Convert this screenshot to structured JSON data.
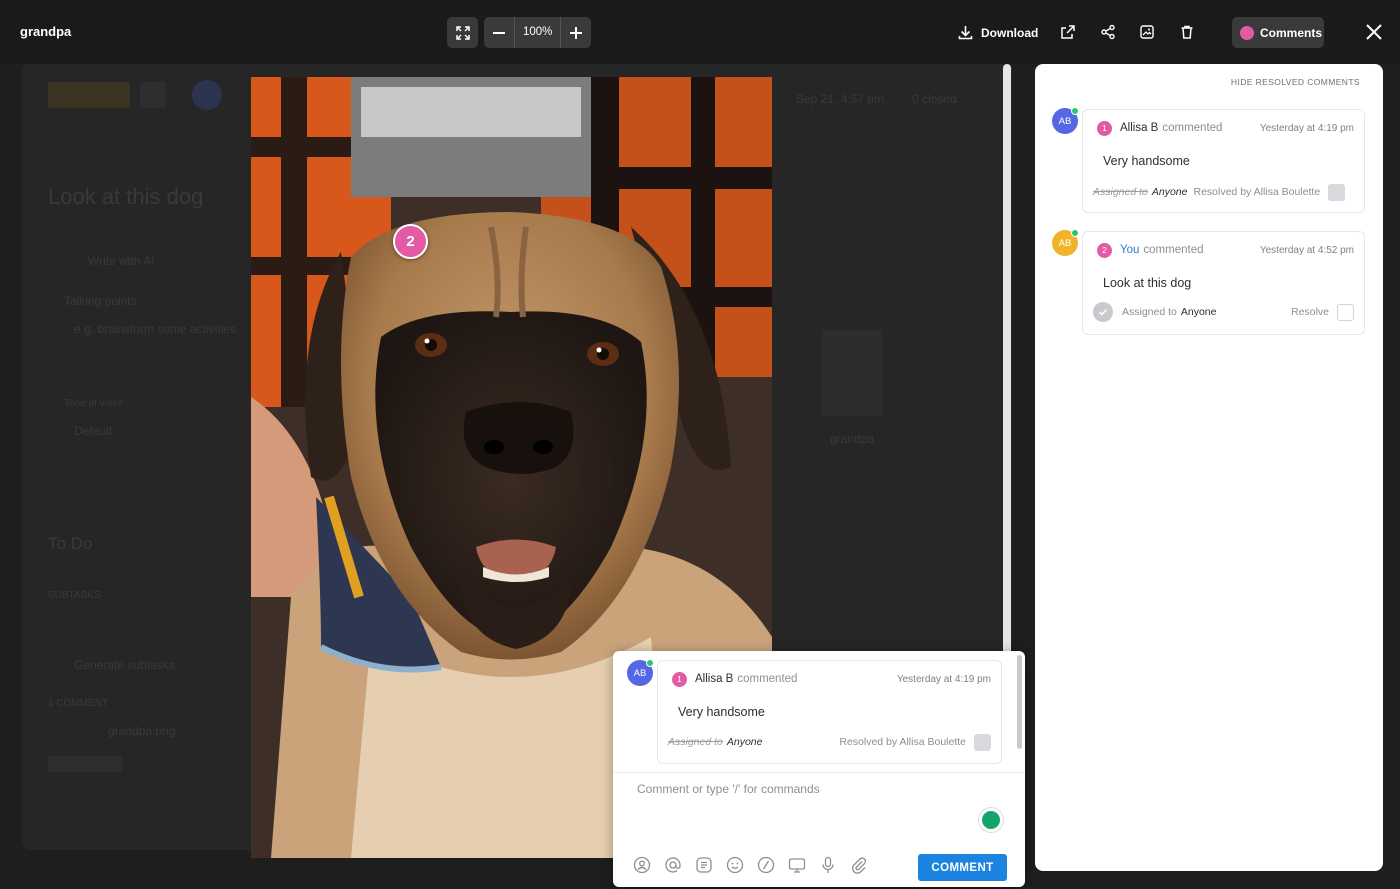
{
  "topbar": {
    "file_name": "grandpa",
    "zoom": "100%",
    "download_label": "Download",
    "comments_label": "Comments"
  },
  "background_page": {
    "title": "Look at this dog",
    "write_ai": "Write with AI",
    "talking_points": "Talking points",
    "talking_points_placeholder": "e.g. brainstorm some activities",
    "tone_label": "Tone of voice",
    "tone_value": "Default",
    "status": "To Do",
    "subtasks": "SUBTASKS",
    "generate_subtasks": "Generate subtasks",
    "comment_count": "1 COMMENT",
    "attachment_name": "grandpa.png",
    "attachment_caption": "grandpa",
    "created_date": "Sep 21, 4:57 pm",
    "assignee_status": "0 closed"
  },
  "image": {
    "pin_number": "2"
  },
  "sidebar": {
    "hide_resolved": "HIDE RESOLVED COMMENTS",
    "comments": [
      {
        "avatar": "AB",
        "avatar_color": "#5468e6",
        "number": "1",
        "author": "Allisa B",
        "verb": "commented",
        "time": "Yesterday at 4:19 pm",
        "text": "Very handsome",
        "assigned_label": "Assigned to",
        "assignee": "Anyone",
        "status": "Resolved by Allisa Boulette",
        "resolved": true
      },
      {
        "avatar": "AB",
        "avatar_color": "#f0b429",
        "number": "2",
        "author": "You",
        "verb": "commented",
        "time": "Yesterday at 4:52 pm",
        "text": "Look at this dog",
        "assigned_label": "Assigned to",
        "assignee": "Anyone",
        "status": "Resolve",
        "resolved": false
      }
    ]
  },
  "popup": {
    "avatar": "AB",
    "number": "1",
    "author": "Allisa B",
    "verb": "commented",
    "time": "Yesterday at 4:19 pm",
    "text": "Very handsome",
    "assigned_label": "Assigned to",
    "assignee": "Anyone",
    "status": "Resolved by Allisa Boulette",
    "input_placeholder": "Comment or type '/' for commands",
    "submit_label": "COMMENT"
  }
}
